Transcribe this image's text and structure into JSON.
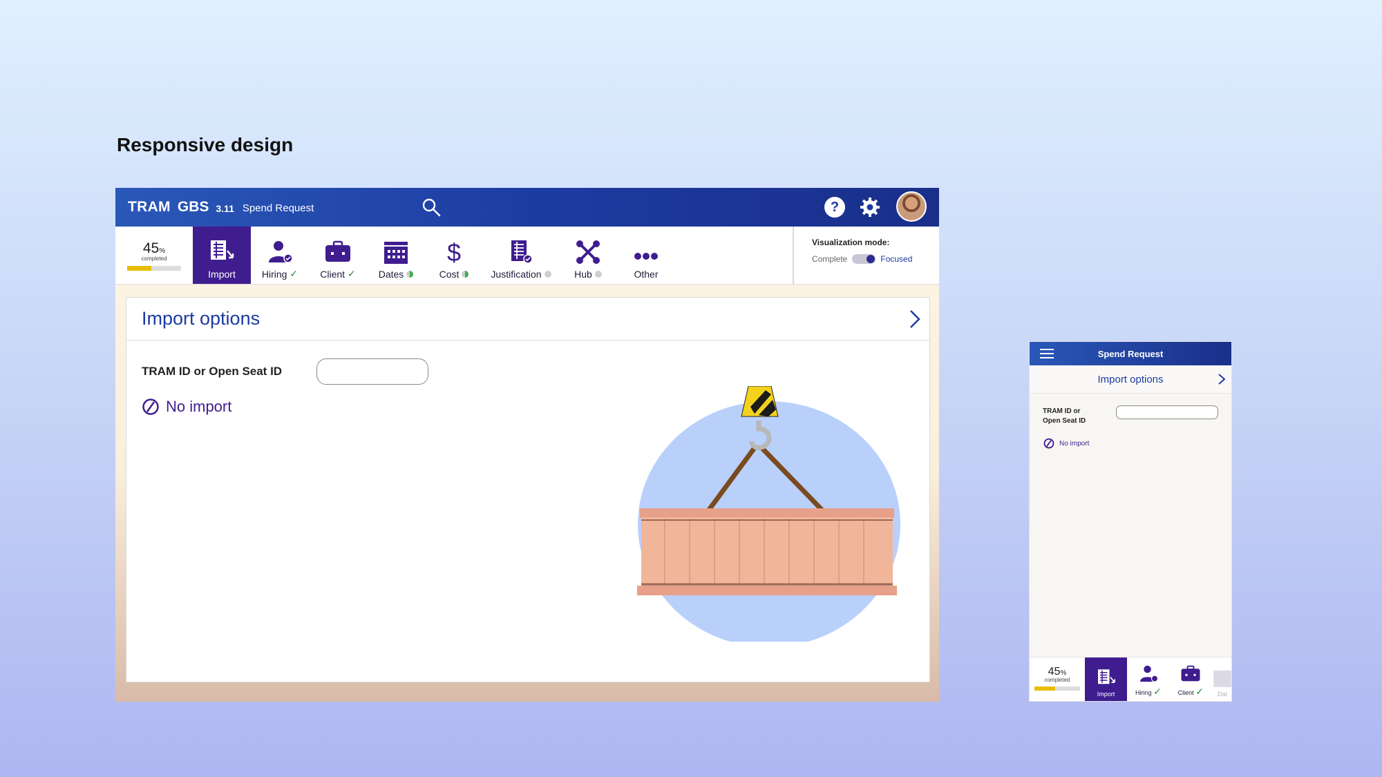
{
  "slide_title": "Responsive design",
  "desktop": {
    "app_name": "TRAM",
    "app_name2": "GBS",
    "version": "3.11",
    "page_name": "Spend Request",
    "help_label": "?",
    "progress": {
      "percent": "45",
      "unit": "%",
      "label": "completed",
      "fraction": 0.45
    },
    "nav": [
      {
        "label": "Import",
        "status": "active"
      },
      {
        "label": "Hiring",
        "status": "complete"
      },
      {
        "label": "Client",
        "status": "complete"
      },
      {
        "label": "Dates",
        "status": "partial"
      },
      {
        "label": "Cost",
        "status": "partial"
      },
      {
        "label": "Justification",
        "status": "empty"
      },
      {
        "label": "Hub",
        "status": "empty"
      },
      {
        "label": "Other",
        "status": "none"
      }
    ],
    "viz_mode": {
      "title": "Visualization mode:",
      "left": "Complete",
      "right": "Focused"
    },
    "card": {
      "title": "Import options",
      "field_label": "TRAM ID or Open Seat ID",
      "field_value": "",
      "no_import": "No import"
    },
    "colors": {
      "accent": "#3f1d8f",
      "brand_blue": "#1c3aa0",
      "progress": "#e8bd00",
      "success": "#2d8a3a"
    }
  },
  "mobile": {
    "title": "Spend Request",
    "header": "Import options",
    "field_label_line1": "TRAM ID or",
    "field_label_line2": "Open Seat ID",
    "no_import": "No import",
    "progress": {
      "percent": "45",
      "unit": "%",
      "label": "completed"
    },
    "nav": [
      {
        "label": "Import"
      },
      {
        "label": "Hiring"
      },
      {
        "label": "Client"
      },
      {
        "label": "Dat"
      }
    ]
  }
}
